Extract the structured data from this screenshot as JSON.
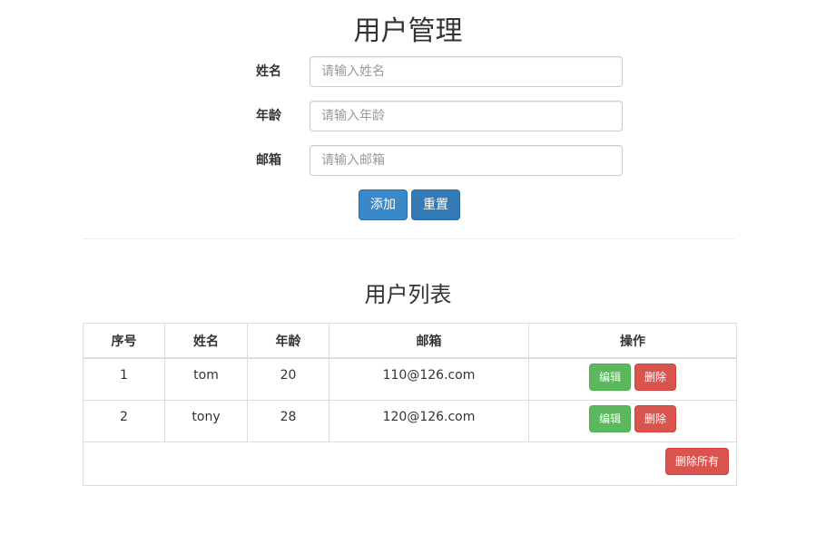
{
  "page": {
    "title": "用户管理"
  },
  "form": {
    "name": {
      "label": "姓名",
      "placeholder": "请输入姓名",
      "value": ""
    },
    "age": {
      "label": "年龄",
      "placeholder": "请输入年龄",
      "value": ""
    },
    "email": {
      "label": "邮箱",
      "placeholder": "请输入邮箱",
      "value": ""
    },
    "add_label": "添加",
    "reset_label": "重置"
  },
  "list": {
    "title": "用户列表",
    "columns": [
      "序号",
      "姓名",
      "年龄",
      "邮箱",
      "操作"
    ],
    "rows": [
      {
        "index": "1",
        "name": "tom",
        "age": "20",
        "email": "110@126.com",
        "edit_label": "编辑",
        "delete_label": "删除"
      },
      {
        "index": "2",
        "name": "tony",
        "age": "28",
        "email": "120@126.com",
        "edit_label": "编辑",
        "delete_label": "删除"
      }
    ],
    "delete_all_label": "删除所有"
  },
  "colors": {
    "primary": "#337ab7",
    "success": "#5cb85c",
    "danger": "#d9534f",
    "border": "#dddddd"
  }
}
